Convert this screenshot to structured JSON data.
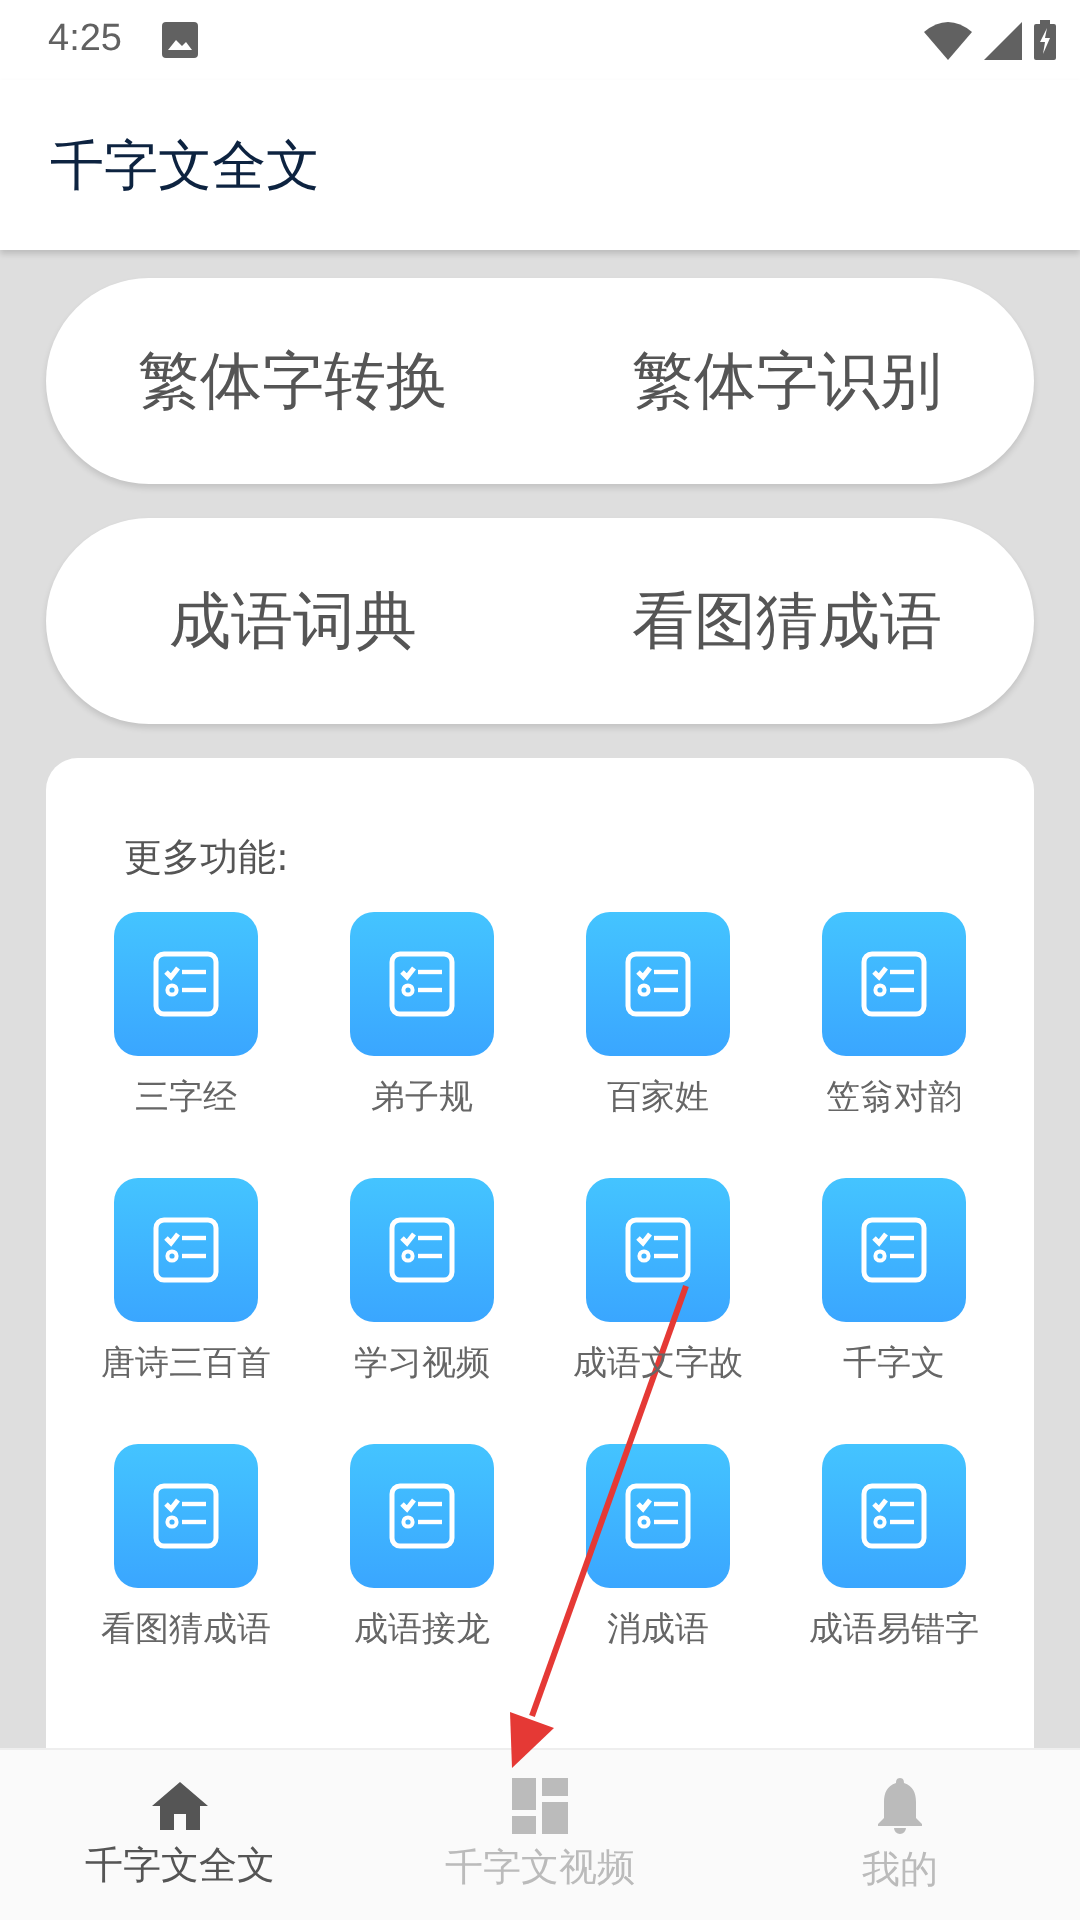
{
  "status_bar": {
    "time": "4:25"
  },
  "app_bar": {
    "title": "千字文全文"
  },
  "pill_rows": [
    {
      "buttons": [
        "繁体字转换",
        "繁体字识别"
      ]
    },
    {
      "buttons": [
        "成语词典",
        "看图猜成语"
      ]
    }
  ],
  "more_panel": {
    "heading": "更多功能:",
    "items": [
      "三字经",
      "弟子规",
      "百家姓",
      "笠翁对韵",
      "唐诗三百首",
      "学习视频",
      "成语文字故",
      "千字文",
      "看图猜成语",
      "成语接龙",
      "消成语",
      "成语易错字"
    ]
  },
  "bottom_nav": [
    {
      "label": "千字文全文",
      "kind": "home",
      "selected": true
    },
    {
      "label": "千字文视频",
      "kind": "dashboard",
      "selected": false
    },
    {
      "label": "我的",
      "kind": "bell",
      "selected": false
    }
  ],
  "annotation": {
    "kind": "arrow"
  }
}
